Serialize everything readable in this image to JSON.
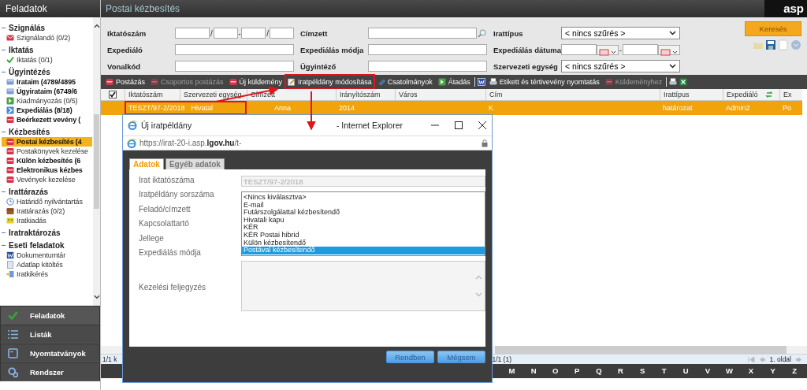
{
  "sidebar": {
    "title": "Feladatok",
    "sections": [
      {
        "title": "Szignálás",
        "items": [
          {
            "label": "Szignálandó (0/2)",
            "kind": "envelope",
            "bold": false,
            "selected": false
          }
        ]
      },
      {
        "title": "Iktatás",
        "items": [
          {
            "label": "Iktatás (0/1)",
            "kind": "check",
            "bold": false,
            "selected": false
          }
        ]
      },
      {
        "title": "Ügyintézés",
        "items": [
          {
            "label": "Irataim (4789/4895",
            "kind": "doc",
            "bold": true,
            "selected": false
          },
          {
            "label": "Ügyirataim (6749/6",
            "kind": "doc",
            "bold": true,
            "selected": false
          },
          {
            "label": "Kiadmányozás (0/5)",
            "kind": "go",
            "bold": false,
            "selected": false
          },
          {
            "label": "Expediálás (8/18)",
            "kind": "forward",
            "bold": true,
            "selected": false
          },
          {
            "label": "Beérkezett vevény (",
            "kind": "red",
            "bold": true,
            "selected": false
          }
        ]
      },
      {
        "title": "Kézbesítés",
        "items": [
          {
            "label": "Postai kézbesítés (4",
            "kind": "red",
            "bold": true,
            "selected": true
          },
          {
            "label": "Postakönyvek kezelése",
            "kind": "red",
            "bold": false,
            "selected": false
          },
          {
            "label": "Külön kézbesítés (6",
            "kind": "red",
            "bold": true,
            "selected": false
          },
          {
            "label": "Elektronikus kézbes",
            "kind": "red",
            "bold": true,
            "selected": false
          },
          {
            "label": "Vevények kezelése",
            "kind": "red",
            "bold": false,
            "selected": false
          }
        ]
      },
      {
        "title": "Irattárazás",
        "items": [
          {
            "label": "Határidő nyilvántartás",
            "kind": "clock",
            "bold": false,
            "selected": false
          },
          {
            "label": "Irattárazás (0/2)",
            "kind": "box",
            "bold": false,
            "selected": false
          },
          {
            "label": "Iratkiadás",
            "kind": "yellow",
            "bold": false,
            "selected": false
          }
        ]
      },
      {
        "title": "Iratraktározás"
      },
      {
        "title": "Eseti feladatok",
        "items": [
          {
            "label": "Dokumentumtár",
            "kind": "word",
            "bold": false,
            "selected": false
          },
          {
            "label": "Adatlap kitöltés",
            "kind": "page",
            "bold": false,
            "selected": false
          },
          {
            "label": "Iratkikérés",
            "kind": "fetch",
            "bold": false,
            "selected": false
          }
        ]
      }
    ],
    "nav": [
      {
        "label": "Feladatok",
        "selected": true
      },
      {
        "label": "Listák",
        "selected": false
      },
      {
        "label": "Nyomtatványok",
        "selected": false
      },
      {
        "label": "Rendszer",
        "selected": false
      }
    ]
  },
  "header": {
    "title": "Postai kézbesítés",
    "logo": "asp"
  },
  "filters": [
    {
      "label": "Iktatószám",
      "kind": "split",
      "separators": [
        "/",
        "-",
        "/"
      ]
    },
    {
      "label": "Címzett",
      "kind": "lookup"
    },
    {
      "label": "Irattípus",
      "kind": "select",
      "value": "< nincs szűrés >"
    },
    {
      "label": "Expediáló",
      "kind": "text"
    },
    {
      "label": "Expediálás módja",
      "kind": "text"
    },
    {
      "label": "Expediálás dátuma",
      "kind": "daterange",
      "separator": "-"
    },
    {
      "label": "Vonalkód",
      "kind": "text"
    },
    {
      "label": "Ügyintéző",
      "kind": "text"
    },
    {
      "label": "Szervezeti egység",
      "kind": "select",
      "value": "< nincs szűrés >"
    }
  ],
  "search_button": "Keresés",
  "toolbar": [
    {
      "kind": "button",
      "label": "Postázás",
      "disabled": false,
      "highlighted": false
    },
    {
      "kind": "button",
      "label": "Csoportos postázás",
      "disabled": true,
      "highlighted": false
    },
    {
      "kind": "button",
      "label": "Új küldemény",
      "disabled": false,
      "highlighted": false
    },
    {
      "kind": "button",
      "label": "Iratpéldány módosítása",
      "disabled": false,
      "highlighted": true
    },
    {
      "kind": "button",
      "label": "Csatolmányok",
      "disabled": false,
      "highlighted": false
    },
    {
      "kind": "button",
      "label": "Átadás",
      "disabled": false,
      "highlighted": false
    },
    {
      "kind": "separator"
    },
    {
      "kind": "icon"
    },
    {
      "kind": "button",
      "label": "Etikett és tértivevény nyomtatás",
      "disabled": false,
      "highlighted": false
    },
    {
      "kind": "button",
      "label": "Küldeményhez",
      "disabled": true,
      "highlighted": false
    },
    {
      "kind": "separator"
    },
    {
      "kind": "icon"
    },
    {
      "kind": "icon"
    }
  ],
  "table": {
    "select_all": {
      "checked": true
    },
    "columns": [
      {
        "kind": "text",
        "label": "Iktatószám"
      },
      {
        "kind": "text",
        "label": "Szervezeti egység"
      },
      {
        "kind": "text",
        "label": "Címzett"
      },
      {
        "kind": "text",
        "label": "Irányítószám"
      },
      {
        "kind": "text",
        "label": "Város"
      },
      {
        "kind": "text",
        "label": "Cím"
      },
      {
        "kind": "text",
        "label": "Irattípus"
      },
      {
        "kind": "text",
        "label": "Expediáló"
      },
      {
        "kind": "refresh"
      },
      {
        "kind": "text",
        "label": "Ex"
      }
    ],
    "rows": [
      {
        "selected": true,
        "highlighted": true,
        "cells": [
          "TESZT/97-2/2018",
          "Hivatal",
          "Anna",
          "2014",
          null,
          "K",
          "határozat",
          "Admin2",
          null,
          "Po"
        ]
      }
    ]
  },
  "status": {
    "left": "1/1 k",
    "count": "1/1 (1)",
    "page": "1. oldal"
  },
  "alphabet": [
    "M",
    "N",
    "O",
    "P",
    "Q",
    "R",
    "S",
    "T",
    "U",
    "V",
    "W",
    "X",
    "Y",
    "Z"
  ],
  "dialog": {
    "title": "Új iratpéldány",
    "app": "- Internet Explorer",
    "url": "https://irat-20-i.asp.**lgov.hu**/t-",
    "tabs": [
      {
        "label": "Adatok",
        "selected": true
      },
      {
        "label": "Egyéb adatok",
        "selected": false
      }
    ],
    "labels": [
      "Irat iktatószáma",
      "Iratpéldány sorszáma",
      "Feladó/címzett",
      "Kapcsolattartó",
      "Jellege",
      "Expediálás módja"
    ],
    "note_label": "Kezelési feljegyzés",
    "iktatoszam": "TESZT/97-2/2018",
    "options": [
      {
        "label": "<Nincs kiválasztva>",
        "selected": false
      },
      {
        "label": "E-mail",
        "selected": false
      },
      {
        "label": "Futárszolgálattal kézbesítendő",
        "selected": false
      },
      {
        "label": "Hivatali kapu",
        "selected": false
      },
      {
        "label": "KÉR",
        "selected": false
      },
      {
        "label": "KÉR Postai hibrid",
        "selected": false
      },
      {
        "label": "Külön kézbesítendő",
        "selected": false
      },
      {
        "label": "Postával kézbesítendő",
        "selected": true
      }
    ],
    "buttons": [
      "Rendben",
      "Mégsem"
    ]
  }
}
